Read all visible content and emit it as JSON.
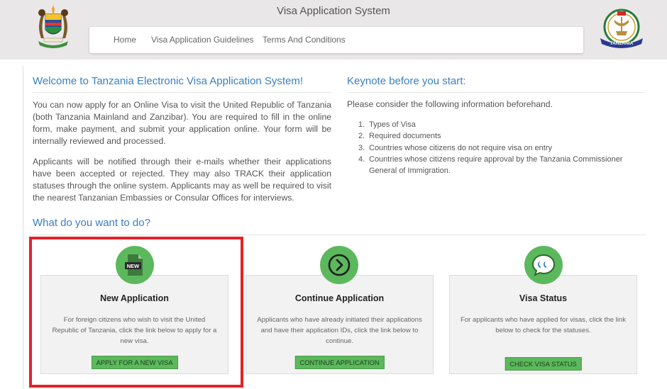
{
  "header": {
    "title": "Visa Application System",
    "nav": [
      "Home",
      "Visa Application Guidelines",
      "Terms And Conditions"
    ],
    "right_logo_text": "TANZANIA"
  },
  "welcome": {
    "heading": "Welcome to Tanzania Electronic Visa Application System!",
    "p1": "You can now apply for an Online Visa to visit the United Republic of Tanzania (both Tanzania Mainland and Zanzibar). You are required to fill in the online form, make payment, and submit your application online. Your form will be internally reviewed and processed.",
    "p2": "Applicants will be notified through their e-mails whether their applications have been accepted or rejected. They may also TRACK their application statuses through the online system. Applicants may as well be required to visit the nearest Tanzanian Embassies or Consular Offices for interviews."
  },
  "keynote": {
    "heading": "Keynote before you start:",
    "intro": "Please consider the following information beforehand.",
    "items": [
      {
        "num": "1.",
        "text": "Types of Visa"
      },
      {
        "num": "2.",
        "text": "Required documents"
      },
      {
        "num": "3.",
        "text": "Countries whose citizens do not require visa on entry"
      },
      {
        "num": "4.",
        "text": "Countries whose citizens require approval by the Tanzania Commissioner General of Immigration."
      }
    ]
  },
  "actions": {
    "heading": "What do you want to do?",
    "cards": [
      {
        "icon": "new-document-icon",
        "badge": "NEW",
        "title": "New Application",
        "desc": "For foreign citizens who wish to visit the United Republic of Tanzania, click the link below to apply for a new visa.",
        "button": "APPLY FOR A NEW VISA"
      },
      {
        "icon": "arrow-right-circle-icon",
        "title": "Continue Application",
        "desc": "Applicants who have already initiated their applications and have their application IDs, click the link below to continue.",
        "button": "CONTINUE APPLICATION"
      },
      {
        "icon": "quote-bubble-icon",
        "title": "Visa Status",
        "desc": "For applicants who have applied for visas, click the link below to check for the statuses.",
        "button": "CHECK VISA STATUS"
      }
    ]
  },
  "colors": {
    "accent_blue": "#3a7fc0",
    "green": "#5cb85c",
    "highlight_red": "#e2232a",
    "header_bg": "#e9e7e7"
  }
}
